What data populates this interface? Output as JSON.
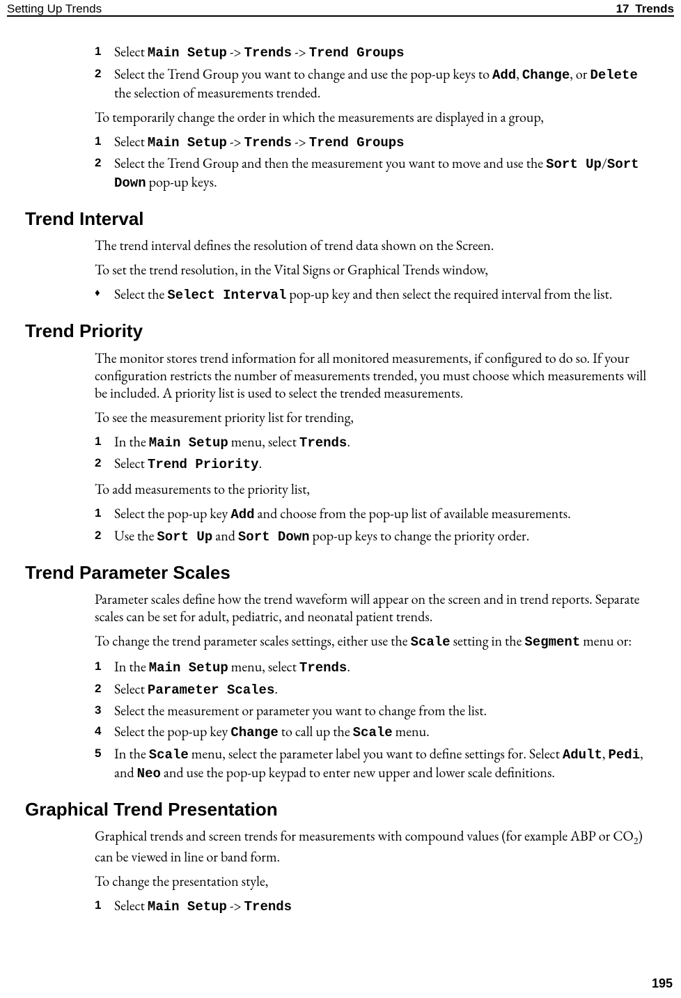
{
  "header": {
    "left": "Setting Up Trends",
    "chapter_number": "17",
    "chapter_name": "Trends"
  },
  "page_number": "195",
  "intro_steps": {
    "step1": {
      "n": "1",
      "t1": "Select ",
      "m1": "Main Setup",
      "t2": " -> ",
      "m2": "Trends",
      "t3": " -> ",
      "m3": "Trend Groups"
    },
    "step2": {
      "n": "2",
      "t1": "Select the Trend Group you want to change and use the pop-up keys to ",
      "m1": "Add",
      "t2": ", ",
      "m2": "Change",
      "t3": ", or ",
      "m3": "Delete",
      "t4": " the selection of measurements trended."
    },
    "after": "To temporarily change the order in which the measurements are displayed in a group,"
  },
  "order_steps": {
    "step1": {
      "n": "1",
      "t1": "Select ",
      "m1": "Main Setup",
      "t2": " -> ",
      "m2": "Trends",
      "t3": " -> ",
      "m3": "Trend Groups"
    },
    "step2": {
      "n": "2",
      "t1": "Select the Trend Group and then the measurement you want to move and use the ",
      "m1": "Sort Up",
      "t2": "/",
      "m2": "Sort Down",
      "t3": " pop-up keys."
    }
  },
  "trend_interval": {
    "heading": "Trend Interval",
    "p1": "The trend interval defines the resolution of trend data shown on the Screen.",
    "p2": "To set the trend resolution, in the Vital Signs or Graphical Trends window,",
    "bullet": {
      "t1": "Select the ",
      "m1": "Select Interval",
      "t2": " pop-up key and then select the required interval from the list."
    }
  },
  "trend_priority": {
    "heading": "Trend Priority",
    "p1": "The monitor stores trend information for all monitored measurements, if configured to do so. If your configuration restricts the number of measurements trended, you must choose which measurements will be included. A priority list is used to select the trended measurements.",
    "p2": "To see the measurement priority list for trending,",
    "viewsteps": {
      "s1": {
        "n": "1",
        "t1": "In the ",
        "m1": "Main Setup",
        "t2": " menu, select ",
        "m2": "Trends",
        "t3": "."
      },
      "s2": {
        "n": "2",
        "t1": "Select ",
        "m1": "Trend Priority",
        "t2": "."
      }
    },
    "p3": "To add measurements to the priority list,",
    "addsteps": {
      "s1": {
        "n": "1",
        "t1": "Select the pop-up key ",
        "m1": "Add",
        "t2": " and choose from the pop-up list of available measurements."
      },
      "s2": {
        "n": "2",
        "t1": "Use the ",
        "m1": "Sort Up",
        "t2": " and ",
        "m2": "Sort Down",
        "t3": " pop-up keys to change the priority order."
      }
    }
  },
  "trend_scales": {
    "heading": "Trend Parameter Scales",
    "p1": "Parameter scales define how the trend waveform will appear on the screen and in trend reports. Separate scales can be set for adult, pediatric, and neonatal patient trends.",
    "p2a": "To change the trend parameter scales settings, either use the ",
    "p2m1": "Scale",
    "p2b": " setting in the ",
    "p2m2": "Segment",
    "p2c": " menu or:",
    "steps": {
      "s1": {
        "n": "1",
        "t1": "In the ",
        "m1": "Main Setup",
        "t2": " menu, select ",
        "m2": "Trends",
        "t3": "."
      },
      "s2": {
        "n": "2",
        "t1": "Select ",
        "m1": "Parameter Scales",
        "t2": "."
      },
      "s3": {
        "n": "3",
        "t1": "Select the measurement or parameter you want to change from the list."
      },
      "s4": {
        "n": "4",
        "t1": "Select the pop-up key ",
        "m1": "Change",
        "t2": " to call up the ",
        "m2": "Scale",
        "t3": " menu."
      },
      "s5": {
        "n": "5",
        "t1": "In the ",
        "m1": "Scale",
        "t2": " menu, select the parameter label you want to define settings for. Select ",
        "m2": "Adult",
        "t3": ", ",
        "m3": "Pedi",
        "t4": ", and ",
        "m4": "Neo",
        "t5": " and use the pop-up keypad to enter new upper and lower scale definitions."
      }
    }
  },
  "graphical": {
    "heading": "Graphical Trend Presentation",
    "p1a": "Graphical trends and screen trends for measurements with compound values (for example ABP or CO",
    "p1sub": "2",
    "p1b": ") can be viewed in line or band form.",
    "p2": "To change the presentation style,",
    "steps": {
      "s1": {
        "n": "1",
        "t1": "Select ",
        "m1": "Main Setup",
        "t2": " -> ",
        "m2": "Trends"
      }
    }
  }
}
